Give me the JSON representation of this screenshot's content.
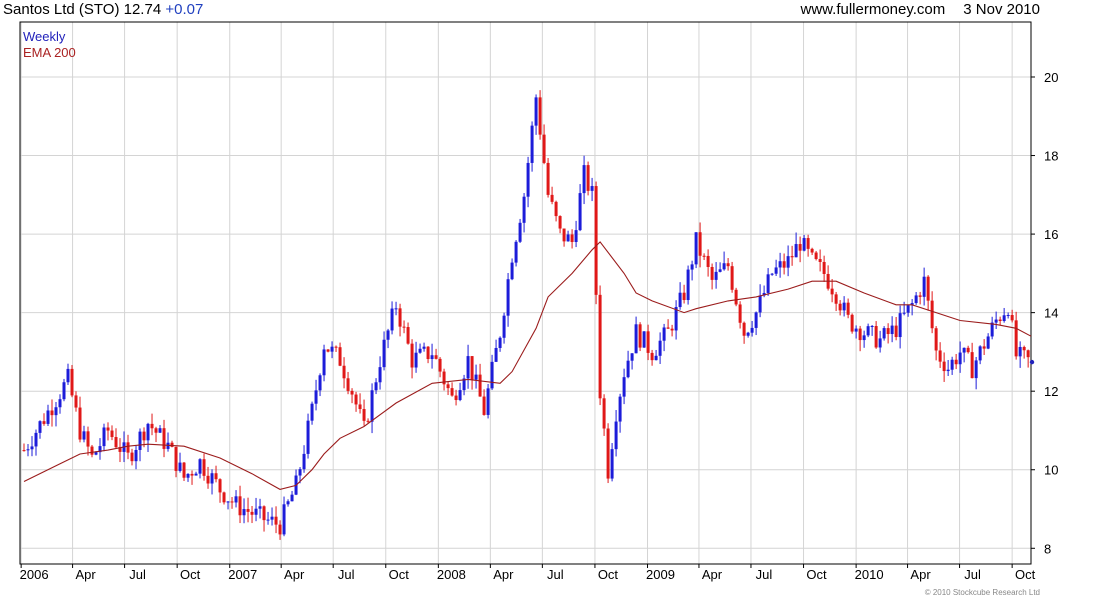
{
  "header": {
    "title": "Santos Ltd (STO)",
    "price": "12.74",
    "change": "+0.07",
    "site": "www.fullermoney.com",
    "date": "3 Nov 2010"
  },
  "legend": {
    "series1": "Weekly",
    "series2": "EMA 200"
  },
  "copyright": "© 2010 Stockcube Research Ltd",
  "colors": {
    "up": "#1c1cd9",
    "down": "#e01818",
    "ema": "#9b1c1c",
    "grid": "#d4d4d4"
  },
  "chart_data": {
    "type": "candlestick",
    "frequency": "Weekly",
    "x_ticks": [
      "2006",
      "Apr",
      "Jul",
      "Oct",
      "2007",
      "Apr",
      "Jul",
      "Oct",
      "2008",
      "Apr",
      "Jul",
      "Oct",
      "2009",
      "Apr",
      "Jul",
      "Oct",
      "2010",
      "Apr",
      "Jul",
      "Oct"
    ],
    "y_ticks": [
      8,
      10,
      12,
      14,
      16,
      18,
      20
    ],
    "ylim": [
      7.6,
      21.4
    ],
    "grid": true,
    "legend_position": "top-left",
    "close_anchors": [
      [
        "2006-01-06",
        10.5
      ],
      [
        "2006-03-03",
        11.8
      ],
      [
        "2006-03-24",
        12.3
      ],
      [
        "2006-04-14",
        11.0
      ],
      [
        "2006-05-05",
        10.3
      ],
      [
        "2006-06-02",
        11.0
      ],
      [
        "2006-07-07",
        10.3
      ],
      [
        "2006-08-11",
        11.2
      ],
      [
        "2006-09-15",
        10.6
      ],
      [
        "2006-10-13",
        9.8
      ],
      [
        "2006-11-10",
        10.2
      ],
      [
        "2006-12-15",
        9.5
      ],
      [
        "2007-01-12",
        9.1
      ],
      [
        "2007-02-09",
        8.9
      ],
      [
        "2007-03-09",
        8.7
      ],
      [
        "2007-03-30",
        8.6
      ],
      [
        "2007-04-27",
        9.6
      ],
      [
        "2007-05-25",
        11.5
      ],
      [
        "2007-06-15",
        13.2
      ],
      [
        "2007-07-13",
        12.8
      ],
      [
        "2007-08-03",
        12.0
      ],
      [
        "2007-08-24",
        11.0
      ],
      [
        "2007-09-21",
        12.8
      ],
      [
        "2007-10-19",
        14.2
      ],
      [
        "2007-11-16",
        12.8
      ],
      [
        "2007-12-21",
        13.0
      ],
      [
        "2008-01-25",
        11.8
      ],
      [
        "2008-02-22",
        12.8
      ],
      [
        "2008-03-21",
        11.5
      ],
      [
        "2008-04-18",
        13.5
      ],
      [
        "2008-05-09",
        15.5
      ],
      [
        "2008-05-30",
        17.0
      ],
      [
        "2008-06-20",
        19.5
      ],
      [
        "2008-07-11",
        17.0
      ],
      [
        "2008-08-01",
        16.0
      ],
      [
        "2008-08-22",
        15.8
      ],
      [
        "2008-09-12",
        17.5
      ],
      [
        "2008-09-26",
        17.0
      ],
      [
        "2008-10-10",
        12.0
      ],
      [
        "2008-10-24",
        10.0
      ],
      [
        "2008-11-07",
        11.5
      ],
      [
        "2008-11-21",
        12.5
      ],
      [
        "2008-12-12",
        13.5
      ],
      [
        "2009-01-09",
        13.0
      ],
      [
        "2009-02-06",
        13.5
      ],
      [
        "2009-03-06",
        14.5
      ],
      [
        "2009-03-27",
        15.8
      ],
      [
        "2009-04-24",
        14.8
      ],
      [
        "2009-05-22",
        15.2
      ],
      [
        "2009-06-19",
        13.5
      ],
      [
        "2009-07-10",
        14.0
      ],
      [
        "2009-08-07",
        15.0
      ],
      [
        "2009-09-04",
        15.3
      ],
      [
        "2009-09-25",
        15.8
      ],
      [
        "2009-10-16",
        15.3
      ],
      [
        "2009-11-06",
        15.0
      ],
      [
        "2009-11-27",
        14.5
      ],
      [
        "2009-12-18",
        13.8
      ],
      [
        "2010-01-15",
        13.5
      ],
      [
        "2010-02-12",
        13.3
      ],
      [
        "2010-03-12",
        13.6
      ],
      [
        "2010-04-09",
        14.2
      ],
      [
        "2010-04-30",
        14.8
      ],
      [
        "2010-05-21",
        13.0
      ],
      [
        "2010-06-11",
        12.6
      ],
      [
        "2010-07-02",
        13.0
      ],
      [
        "2010-07-23",
        12.6
      ],
      [
        "2010-08-13",
        13.2
      ],
      [
        "2010-09-03",
        13.8
      ],
      [
        "2010-09-24",
        14.2
      ],
      [
        "2010-10-08",
        12.9
      ],
      [
        "2010-11-03",
        12.74
      ]
    ],
    "ema_points": [
      [
        "2006-01-06",
        9.7
      ],
      [
        "2006-03-03",
        10.1
      ],
      [
        "2006-04-14",
        10.4
      ],
      [
        "2006-06-02",
        10.5
      ],
      [
        "2006-07-07",
        10.6
      ],
      [
        "2006-08-11",
        10.65
      ],
      [
        "2006-10-13",
        10.6
      ],
      [
        "2006-12-15",
        10.3
      ],
      [
        "2007-02-09",
        9.9
      ],
      [
        "2007-03-30",
        9.5
      ],
      [
        "2007-04-27",
        9.6
      ],
      [
        "2007-05-25",
        10.0
      ],
      [
        "2007-06-15",
        10.4
      ],
      [
        "2007-07-13",
        10.8
      ],
      [
        "2007-08-24",
        11.1
      ],
      [
        "2007-10-19",
        11.7
      ],
      [
        "2007-12-21",
        12.2
      ],
      [
        "2008-02-22",
        12.3
      ],
      [
        "2008-04-18",
        12.2
      ],
      [
        "2008-05-09",
        12.5
      ],
      [
        "2008-06-20",
        13.6
      ],
      [
        "2008-07-11",
        14.4
      ],
      [
        "2008-08-22",
        15.0
      ],
      [
        "2008-09-26",
        15.6
      ],
      [
        "2008-10-10",
        15.8
      ],
      [
        "2008-11-21",
        15.0
      ],
      [
        "2008-12-12",
        14.5
      ],
      [
        "2009-01-09",
        14.3
      ],
      [
        "2009-03-06",
        14.0
      ],
      [
        "2009-03-27",
        14.1
      ],
      [
        "2009-05-22",
        14.3
      ],
      [
        "2009-07-10",
        14.4
      ],
      [
        "2009-09-04",
        14.6
      ],
      [
        "2009-10-16",
        14.8
      ],
      [
        "2009-11-27",
        14.8
      ],
      [
        "2010-01-15",
        14.5
      ],
      [
        "2010-03-12",
        14.2
      ],
      [
        "2010-04-09",
        14.2
      ],
      [
        "2010-05-21",
        14.0
      ],
      [
        "2010-07-02",
        13.8
      ],
      [
        "2010-09-03",
        13.7
      ],
      [
        "2010-10-08",
        13.6
      ],
      [
        "2010-11-03",
        13.4
      ]
    ]
  }
}
